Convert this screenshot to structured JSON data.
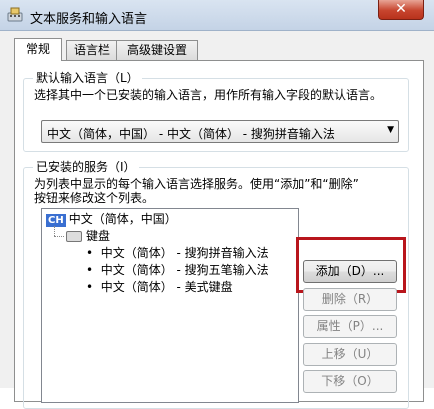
{
  "window": {
    "title": "文本服务和输入语言",
    "close_label": "✕"
  },
  "tabs": [
    "常规",
    "语言栏",
    "高级键设置"
  ],
  "default_lang": {
    "title": "默认输入语言（L）",
    "description": "选择其中一个已安装的输入语言，用作所有输入字段的默认语言。",
    "selected": "中文（简体，中国） - 中文（简体） - 搜狗拼音输入法"
  },
  "installed": {
    "title": "已安装的服务（I）",
    "description_line1": "为列表中显示的每个输入语言选择服务。使用“添加”和“删除”",
    "description_line2": "按钮来修改这个列表。",
    "language_badge": "CH",
    "language": "中文（简体，中国）",
    "category": "键盘",
    "services": [
      "中文（简体） - 搜狗拼音输入法",
      "中文（简体） - 搜狗五笔输入法",
      "中文（简体） - 美式键盘"
    ],
    "bullet": "•"
  },
  "buttons": {
    "add": "添加（D）...",
    "remove": "删除（R）",
    "properties": "属性（P）...",
    "move_up": "上移（U）",
    "move_down": "下移（O）"
  },
  "colors": {
    "highlight": "#b8161c"
  }
}
